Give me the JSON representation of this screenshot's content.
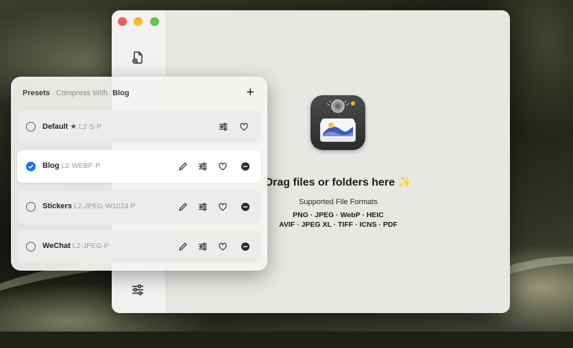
{
  "popover": {
    "header_presets": "Presets",
    "header_compress_with": "Compress With",
    "header_current": "Blog",
    "add_label": "+",
    "presets": [
      {
        "name": "Default",
        "star": "★",
        "meta": "L2·S·P",
        "checked": false
      },
      {
        "name": "Blog",
        "star": "",
        "meta": "L2·WEBP·P",
        "checked": true
      },
      {
        "name": "Stickers",
        "star": "",
        "meta": "L2·JPEG·W1024·P",
        "checked": false
      },
      {
        "name": "WeChat",
        "star": "",
        "meta": "L2·JPEG·P",
        "checked": false
      }
    ]
  },
  "main": {
    "drop_title": "Drag files or folders here",
    "sparkle": "✨",
    "formats_label": "Supported File Formats",
    "formats_line1": "PNG · JPEG · WebP · HEIC",
    "formats_line2": "AVIF · JPEG XL · TIFF · ICNS · PDF"
  },
  "icons": {
    "sidebar": [
      "new-document-icon",
      "sliders-icon"
    ],
    "row_actions": [
      "pencil-icon",
      "sliders-icon",
      "heart-icon",
      "remove-icon"
    ]
  },
  "colors": {
    "accent": "#1a73e8",
    "close": "#ed5f56",
    "minimize": "#f5bd2f",
    "maximize": "#5fc64a"
  }
}
